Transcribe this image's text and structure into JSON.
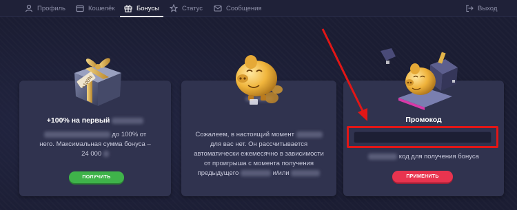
{
  "nav": {
    "tabs": [
      {
        "label": "Профиль",
        "icon": "user-icon"
      },
      {
        "label": "Кошелёк",
        "icon": "wallet-icon"
      },
      {
        "label": "Бонусы",
        "icon": "gift-icon",
        "active": true
      },
      {
        "label": "Статус",
        "icon": "star-icon"
      },
      {
        "label": "Сообщения",
        "icon": "mail-icon"
      }
    ],
    "exit_label": "Выход"
  },
  "cards": [
    {
      "title": "+100% на первый",
      "text_a": "до 100% от",
      "text_b": "него. Максимальная сумма бонуса –",
      "text_c": "24 000",
      "button_label": "ПОЛУЧИТЬ",
      "button_color": "#3fb34a"
    },
    {
      "line1": "Сожалеем, в настоящий момент",
      "line2": "для вас нет. Он рассчитывается",
      "line3": "автоматически ежемесячно в зависимости",
      "line4": "от проигрыша с момента получения",
      "line5a": "предыдущего",
      "line5b": "и/или"
    },
    {
      "title": "Промокод",
      "hint": "код для получения бонуса",
      "button_label": "ПРИМЕНИТЬ",
      "button_color": "#e8344f"
    }
  ],
  "annotation_color": "#e21616"
}
